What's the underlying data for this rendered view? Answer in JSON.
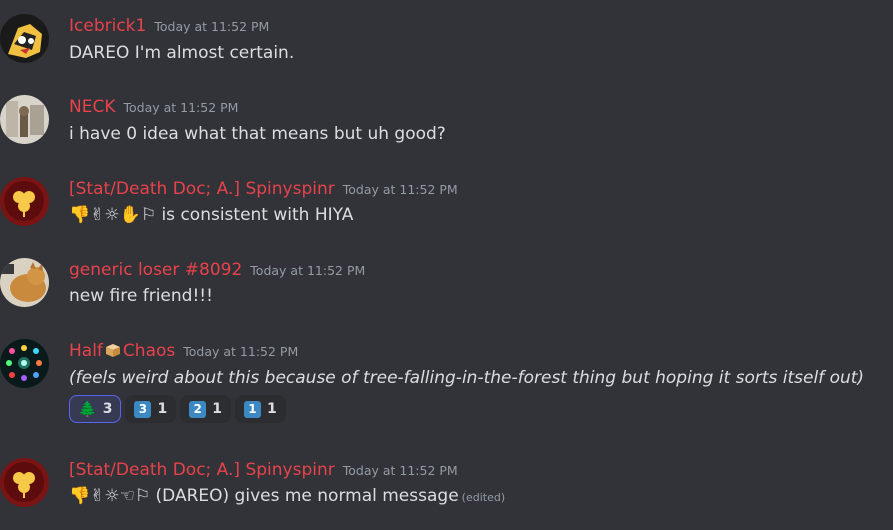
{
  "messages": [
    {
      "author": "Icebrick1",
      "time": "Today at 11:52 PM",
      "text": "DAREO I'm almost certain."
    },
    {
      "author": "NECK",
      "time": "Today at 11:52 PM",
      "text": "i have 0 idea what that means but uh good?"
    },
    {
      "author": "[Stat/Death Doc; A.] Spinyspinr",
      "time": "Today at 11:52 PM",
      "text": "👎✌☼✋⚐ is consistent with HIYA"
    },
    {
      "author": "generic loser #8092",
      "time": "Today at 11:52 PM",
      "text": "new fire friend!!!"
    },
    {
      "author_prefix": "Half",
      "author_suffix": "Chaos",
      "author_emoji": "box",
      "time": "Today at 11:52 PM",
      "text": "(feels weird about this because of tree-falling-in-the-forest thing but hoping it sorts itself out)"
    },
    {
      "author": "[Stat/Death Doc; A.] Spinyspinr",
      "time": "Today at 11:52 PM",
      "text": "👎✌☼☜⚐ (DAREO) gives me normal message",
      "edited": "(edited)"
    }
  ],
  "reactions": [
    {
      "emoji": "🌲",
      "count": "3",
      "active": true
    },
    {
      "emoji": "3",
      "count": "1"
    },
    {
      "emoji": "2",
      "count": "1"
    },
    {
      "emoji": "1",
      "count": "1"
    }
  ],
  "colors": {
    "background": "#313338",
    "username": "#e8424a",
    "timestamp": "#949ba4",
    "text": "#dbdee1",
    "reaction_active_border": "#5865f2"
  }
}
